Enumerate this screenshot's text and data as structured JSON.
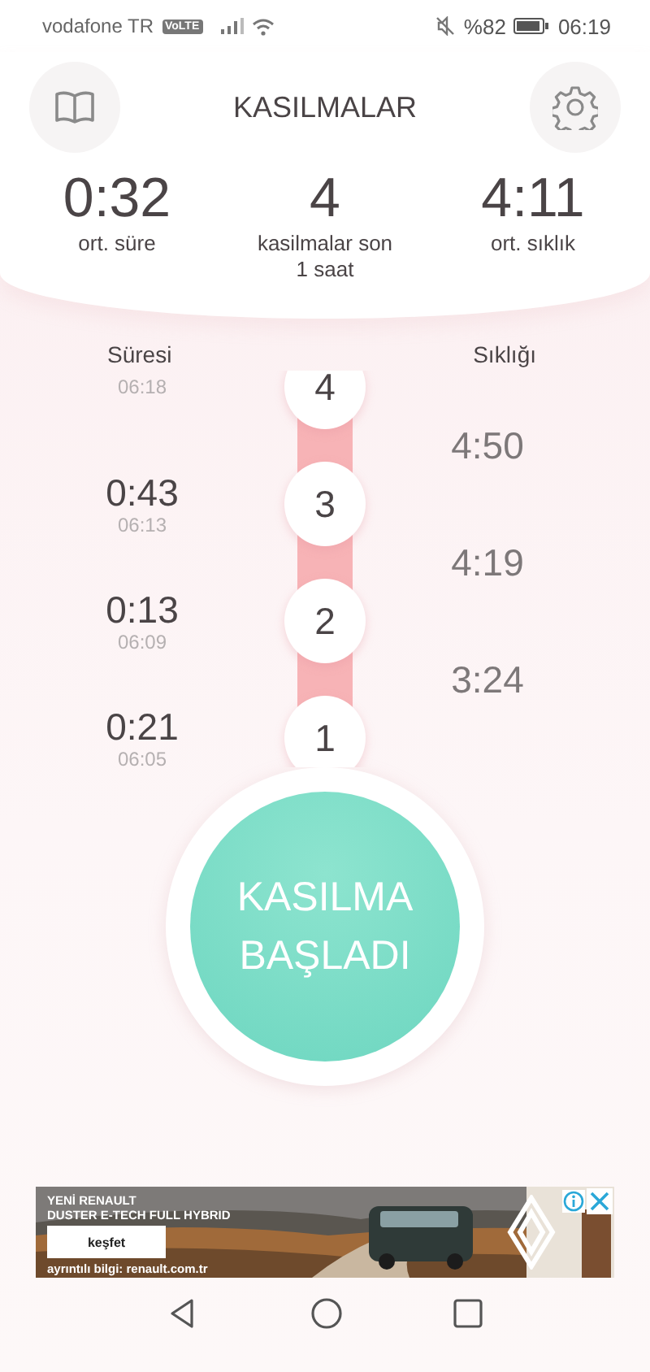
{
  "status_bar": {
    "carrier": "vodafone TR",
    "network_badge": "VoLTE",
    "battery": "%82",
    "time": "06:19"
  },
  "header": {
    "title": "KASILMALAR"
  },
  "stats": [
    {
      "value": "0:32",
      "label": "ort. süre"
    },
    {
      "value": "4",
      "label": "kasilmalar son 1 saat"
    },
    {
      "value": "4:11",
      "label": "ort. sıklık"
    }
  ],
  "columns": {
    "duration": "Süresi",
    "frequency": "Sıklığı"
  },
  "contractions": [
    {
      "number": "4",
      "time": "06:18"
    },
    {
      "number": "3",
      "duration": "0:43",
      "time": "06:13"
    },
    {
      "number": "2",
      "duration": "0:13",
      "time": "06:09"
    },
    {
      "number": "1",
      "duration": "0:21",
      "time": "06:05"
    }
  ],
  "intervals": [
    "4:50",
    "4:19",
    "3:24"
  ],
  "main_button": {
    "label": "KASILMA BAŞLADI"
  },
  "ad": {
    "headline": "YENİ RENAULT",
    "subline": "DUSTER E-TECH FULL HYBRID",
    "button": "keşfet",
    "footer": "ayrıntılı bilgi: renault.com.tr",
    "kind": "picture"
  }
}
